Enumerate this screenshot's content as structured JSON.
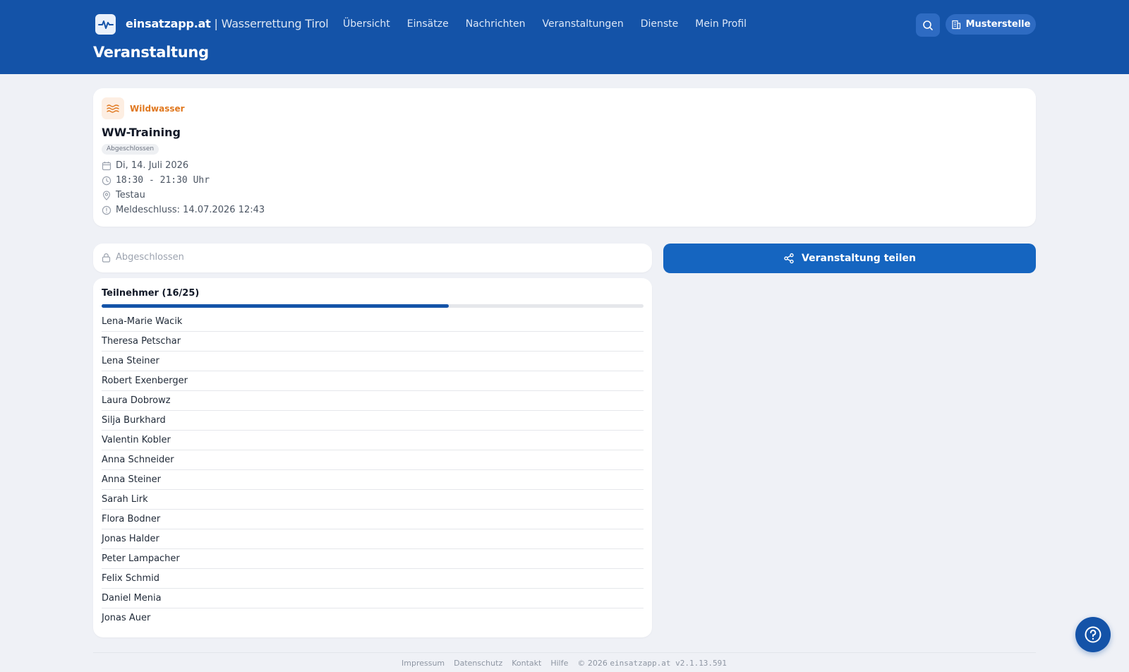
{
  "header": {
    "brand_name": "einsatzapp.at",
    "brand_separator": " | ",
    "brand_org": "Wasserrettung Tirol",
    "nav": [
      {
        "label": "Übersicht"
      },
      {
        "label": "Einsätze"
      },
      {
        "label": "Nachrichten"
      },
      {
        "label": "Veranstaltungen"
      },
      {
        "label": "Dienste"
      },
      {
        "label": "Mein Profil"
      }
    ],
    "page_title": "Veranstaltung",
    "org_button_label": "Musterstelle",
    "search_icon": "search-icon",
    "org_icon": "building-icon"
  },
  "event": {
    "category": "Wildwasser",
    "category_icon": "waves-icon",
    "title": "WW-Training",
    "status": "Abgeschlossen",
    "date": "Di, 14. Juli 2026",
    "time": "18:30 - 21:30 Uhr",
    "location": "Testau",
    "deadline": "Meldeschluss: 14.07.2026 12:43"
  },
  "registration": {
    "status_label": "Abgeschlossen",
    "status_icon": "lock-icon"
  },
  "share": {
    "label": "Veranstaltung teilen",
    "icon": "share-icon"
  },
  "participants": {
    "title": "Teilnehmer (16/25)",
    "count": 16,
    "capacity": 25,
    "names": [
      "Lena-Marie Wacik",
      "Theresa Petschar",
      "Lena Steiner",
      "Robert Exenberger",
      "Laura Dobrowz",
      "Silja Burkhard",
      "Valentin Kobler",
      "Anna Schneider",
      "Anna Steiner",
      "Sarah Lirk",
      "Flora Bodner",
      "Jonas Halder",
      "Peter Lampacher",
      "Felix Schmid",
      "Daniel Menia",
      "Jonas Auer"
    ]
  },
  "footer": {
    "links": [
      {
        "label": "Impressum"
      },
      {
        "label": "Datenschutz"
      },
      {
        "label": "Kontakt"
      },
      {
        "label": "Hilfe"
      }
    ],
    "copyright": "© 2026",
    "version": "einsatzapp.at v2.1.13.591"
  },
  "colors": {
    "header_bg": "#1453a8",
    "accent": "#1565c0",
    "category": "#e0781f",
    "background": "#eff1f6"
  },
  "help_icon": "help-circle-icon"
}
